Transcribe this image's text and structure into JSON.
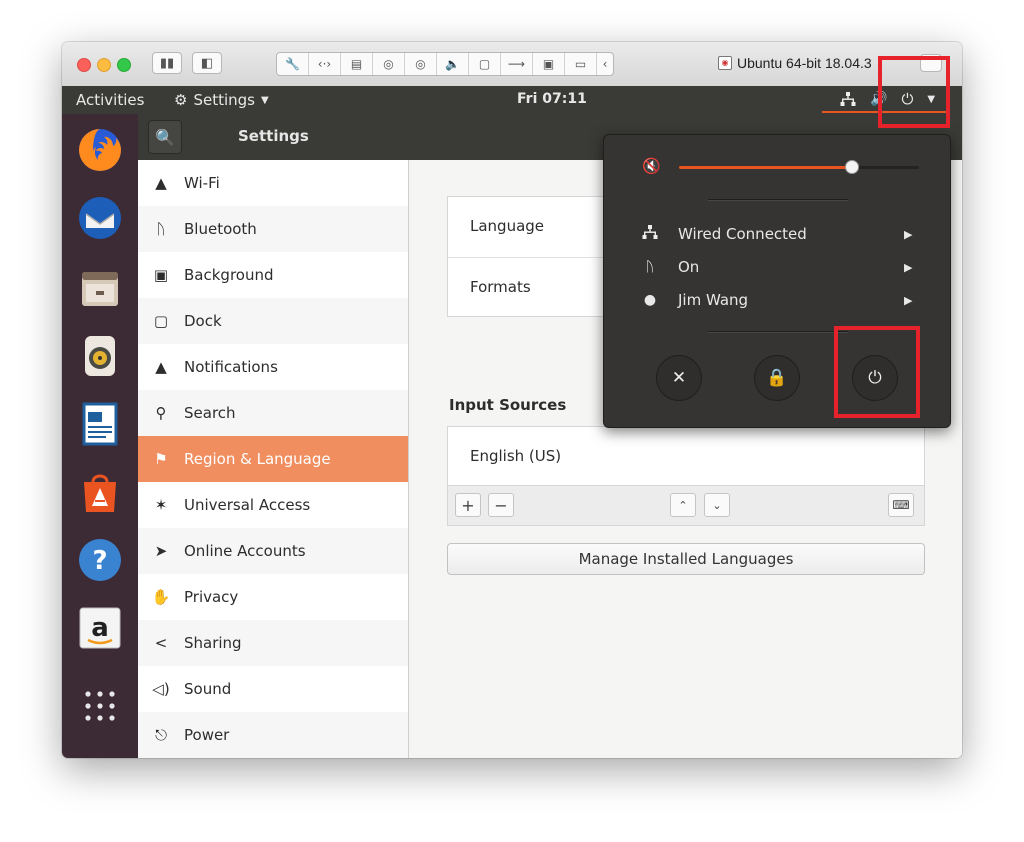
{
  "vm_window": {
    "title": "Ubuntu 64-bit 18.04.3",
    "toolbar_icons": [
      "wrench-icon",
      "code-arrows-icon",
      "drive-icon",
      "camera-icon",
      "camera-icon",
      "speaker-icon",
      "video-icon",
      "usb-icon",
      "floppy-icon",
      "folder-icon",
      "back-chevron-icon"
    ]
  },
  "top_panel": {
    "activities": "Activities",
    "app_menu": "Settings",
    "clock": "Fri 07:11"
  },
  "settings": {
    "title": "Settings",
    "sidebar": [
      {
        "label": "Wi-Fi",
        "icon": "wifi-icon"
      },
      {
        "label": "Bluetooth",
        "icon": "bluetooth-icon"
      },
      {
        "label": "Background",
        "icon": "background-icon"
      },
      {
        "label": "Dock",
        "icon": "dock-icon"
      },
      {
        "label": "Notifications",
        "icon": "bell-icon"
      },
      {
        "label": "Search",
        "icon": "search-icon"
      },
      {
        "label": "Region & Language",
        "icon": "flag-icon",
        "active": true
      },
      {
        "label": "Universal Access",
        "icon": "accessibility-icon"
      },
      {
        "label": "Online Accounts",
        "icon": "accounts-icon"
      },
      {
        "label": "Privacy",
        "icon": "hand-icon"
      },
      {
        "label": "Sharing",
        "icon": "share-icon"
      },
      {
        "label": "Sound",
        "icon": "speaker-icon"
      },
      {
        "label": "Power",
        "icon": "battery-icon"
      }
    ],
    "main": {
      "rows": [
        "Language",
        "Formats"
      ],
      "input_sources_label": "Input Sources",
      "input_sources": [
        "English (US)"
      ],
      "add_label": "+",
      "remove_label": "−",
      "manage_button": "Manage Installed Languages"
    }
  },
  "system_menu": {
    "volume_fraction": 0.72,
    "items": [
      {
        "label": "Wired Connected",
        "icon": "network-icon"
      },
      {
        "label": "On",
        "icon": "bluetooth-icon"
      },
      {
        "label": "Jim Wang",
        "icon": "user-icon"
      }
    ],
    "actions": [
      "settings-icon",
      "lock-icon",
      "power-icon"
    ]
  },
  "colors": {
    "accent": "#e95420",
    "sidebar_active": "#f08e5f",
    "panel": "#3a3a36",
    "highlight": "#e8222b"
  }
}
